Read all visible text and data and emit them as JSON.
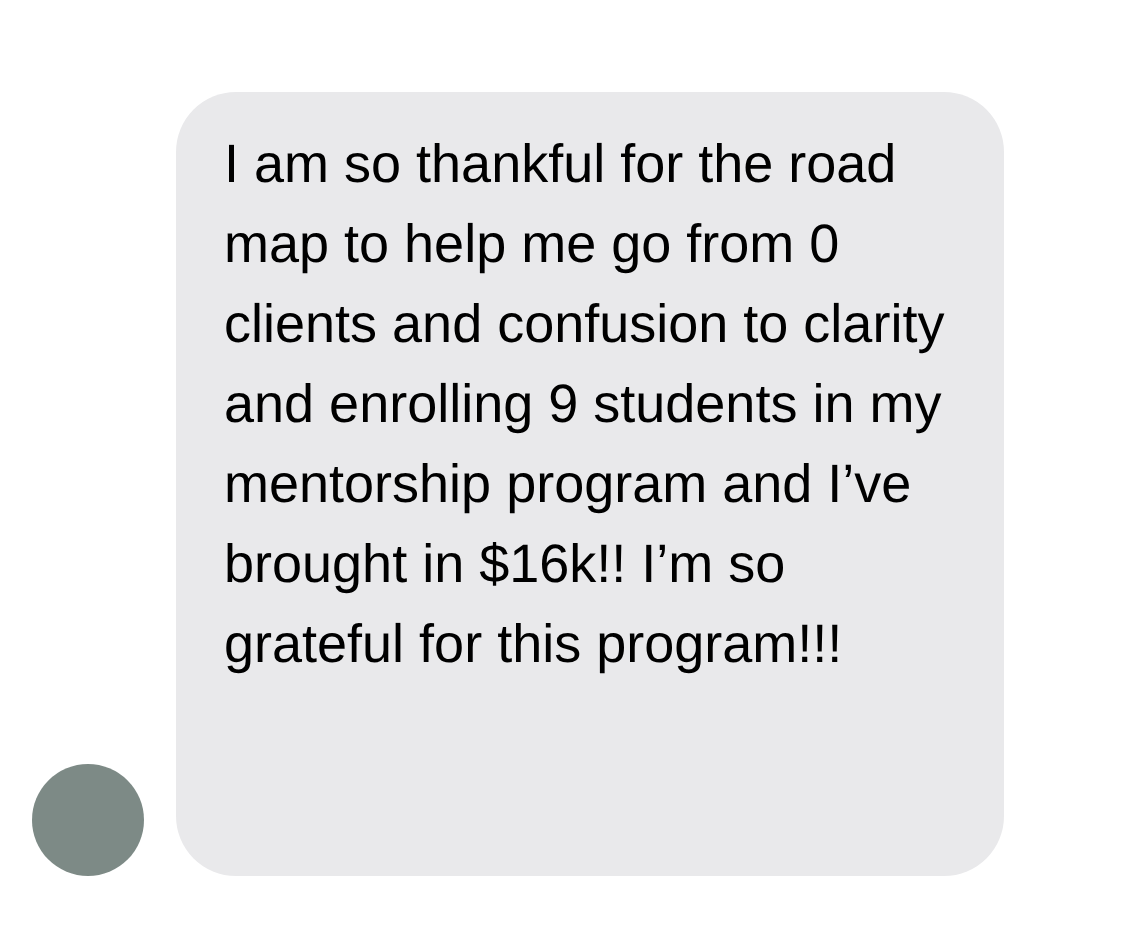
{
  "message": {
    "text": "I am so thankful for the road map to help me go from 0 clients and confusion to clarity and enrolling 9 students in my mentorship program and I’ve brought in $16k!! I’m so grateful for this program!!!"
  }
}
